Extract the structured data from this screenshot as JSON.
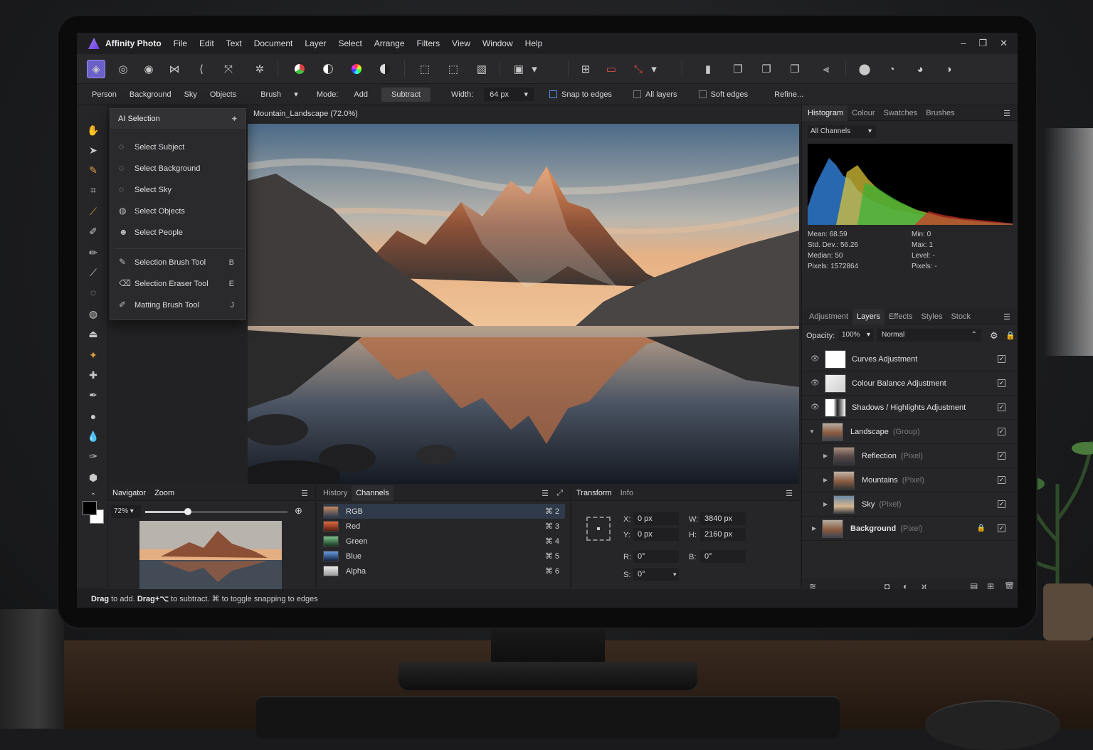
{
  "app": {
    "name": "Affinity Photo"
  },
  "menu": [
    "File",
    "Edit",
    "Text",
    "Document",
    "Layer",
    "Select",
    "Arrange",
    "Filters",
    "View",
    "Window",
    "Help"
  ],
  "window_controls": {
    "min": "–",
    "max": "❐",
    "close": "✕"
  },
  "context_toolbar": {
    "modes": [
      "Person",
      "Background",
      "Sky",
      "Objects"
    ],
    "brush_label": "Brush",
    "mode_label": "Mode:",
    "add": "Add",
    "subtract": "Subtract",
    "width_label": "Width:",
    "width_value": "64 px",
    "snap": "Snap to edges",
    "all_layers": "All layers",
    "soft_edges": "Soft edges",
    "refine": "Refine..."
  },
  "ai_selection": {
    "title": "AI Selection",
    "items": [
      {
        "label": "Select Subject",
        "icon": "subject-icon"
      },
      {
        "label": "Select Background",
        "icon": "background-icon"
      },
      {
        "label": "Select Sky",
        "icon": "sky-icon"
      },
      {
        "label": "Select Objects",
        "icon": "objects-icon"
      },
      {
        "label": "Select People",
        "icon": "people-icon"
      }
    ],
    "tools": [
      {
        "label": "Selection Brush Tool",
        "key": "B"
      },
      {
        "label": "Selection Eraser Tool",
        "key": "E"
      },
      {
        "label": "Matting Brush Tool",
        "key": "J"
      }
    ]
  },
  "document": {
    "tab": "Mountain_Landscape (72.0%)"
  },
  "navigator": {
    "tabs": [
      "Navigator",
      "Zoom"
    ],
    "zoom": "72%",
    "zoom_fraction": 0.3
  },
  "history": {
    "tabs": [
      "History",
      "Channels"
    ],
    "channels": [
      {
        "name": "RGB",
        "shortcut": "⌘ 2"
      },
      {
        "name": "Red",
        "shortcut": "⌘ 3"
      },
      {
        "name": "Green",
        "shortcut": "⌘ 4"
      },
      {
        "name": "Blue",
        "shortcut": "⌘ 5"
      },
      {
        "name": "Alpha",
        "shortcut": "⌘ 6"
      }
    ]
  },
  "transform": {
    "tabs": [
      "Transform",
      "Info"
    ],
    "x_label": "X:",
    "x": "0 px",
    "y_label": "Y:",
    "y": "0 px",
    "w_label": "W:",
    "w": "3840 px",
    "h_label": "H:",
    "h": "2160 px",
    "r_label": "R:",
    "r": "0°",
    "b_label": "B:",
    "b": "0°",
    "s_label": "S:",
    "s": "0°"
  },
  "histogram": {
    "tabs": [
      "Histogram",
      "Colour",
      "Swatches",
      "Brushes"
    ],
    "channel": "All Channels",
    "stats_left": [
      "Mean: 68.59",
      "Std. Dev.: 56.26",
      "Median: 50",
      "Pixels: 1572864"
    ],
    "stats_right": [
      "Min: 0",
      "Max: 1",
      "Level: -",
      "Pixels: -"
    ]
  },
  "layers": {
    "tabs": [
      "Adjustment",
      "Layers",
      "Effects",
      "Styles",
      "Stock"
    ],
    "opacity_label": "Opacity:",
    "opacity": "100%",
    "blend": "Normal",
    "items": [
      {
        "name": "Curves Adjustment",
        "type": "",
        "indent": 0
      },
      {
        "name": "Colour Balance Adjustment",
        "type": "",
        "indent": 0
      },
      {
        "name": "Shadows / Highlights Adjustment",
        "type": "",
        "indent": 0
      },
      {
        "name": "Landscape",
        "type": "(Group)",
        "indent": 0
      },
      {
        "name": "Reflection",
        "type": "(Pixel)",
        "indent": 1
      },
      {
        "name": "Mountains",
        "type": "(Pixel)",
        "indent": 1
      },
      {
        "name": "Sky",
        "type": "(Pixel)",
        "indent": 1
      },
      {
        "name": "Background",
        "type": "(Pixel)",
        "indent": 0
      }
    ]
  },
  "status": {
    "drag": "Drag",
    "to_add": " to add. ",
    "drag_alt": "Drag+⌥",
    "rest": " to subtract.  ⌘ to toggle snapping to edges"
  }
}
